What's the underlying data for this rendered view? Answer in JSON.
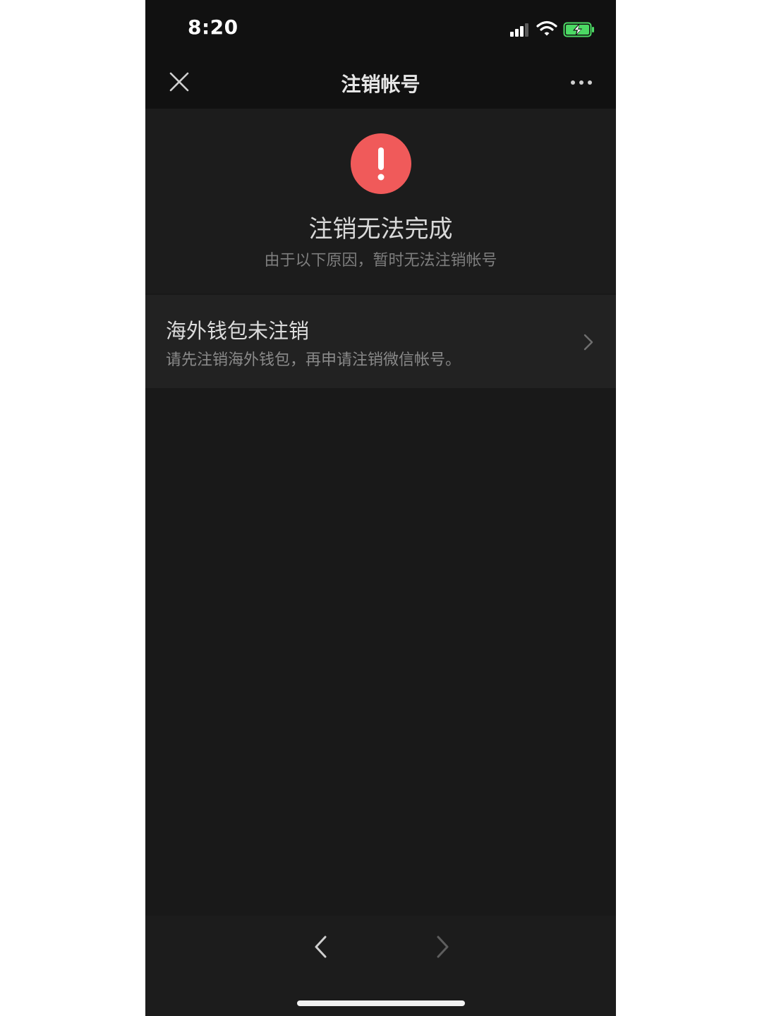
{
  "status_bar": {
    "time": "8:20",
    "icons": [
      "signal-icon",
      "wifi-icon",
      "battery-charging-icon"
    ]
  },
  "nav_bar": {
    "title": "注销帐号",
    "close_icon": "close-icon",
    "more_icon": "more-dots-icon"
  },
  "result": {
    "icon": "exclamation-icon",
    "title": "注销无法完成",
    "subtitle": "由于以下原因，暂时无法注销帐号"
  },
  "reasons": [
    {
      "title": "海外钱包未注销",
      "description": "请先注销海外钱包，再申请注销微信帐号。",
      "icon": "chevron-right-icon"
    }
  ],
  "toolbar": {
    "back_icon": "chevron-left-icon",
    "forward_icon": "chevron-right-icon"
  },
  "colors": {
    "background": "#191919",
    "bar": "#111111",
    "row": "#222222",
    "warning": "#f05a5a",
    "battery": "#4cd964"
  }
}
